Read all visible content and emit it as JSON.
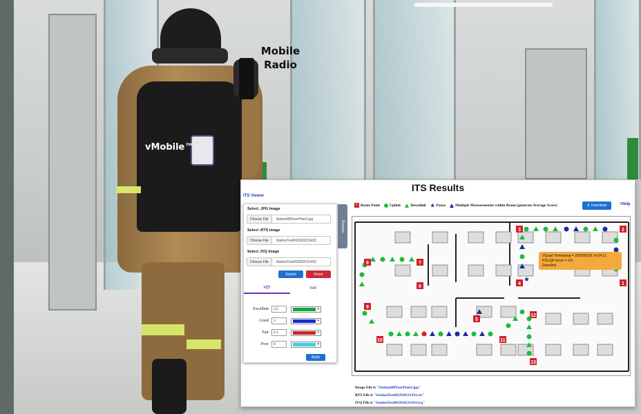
{
  "photo": {
    "mobile_radio_label": "Mobile\nRadio",
    "vmobile_label": "vMobile™"
  },
  "its": {
    "title": "ITS Results",
    "viewer_label": "ITS Viewer",
    "legend": {
      "route_point": "Route Point",
      "uplink": "Uplink",
      "downlink": "Downlink",
      "pause": "Pause",
      "multiple": "Multiple Measurements within Room (generate Average Score)"
    },
    "download_label": "Download",
    "help_label": "Help",
    "browse_tab": "Browse",
    "controls": {
      "jpg_label": "Select .JPG Image",
      "rts_label": "Select .RTS Image",
      "ivq_label": "Select .IVQ Image",
      "choose_file": "Choose File",
      "jpg_file": "Station80FloorPlan2.jpg",
      "rts_file": "StationTest062920231433",
      "ivq_file": "StationTest062920231433",
      "submit": "Submit",
      "reset": "Reset",
      "tab_vqt": "VQT",
      "tab_bab": "BAB",
      "apply": "Apply",
      "thresholds": [
        {
          "name": "Excellent",
          "value": "3.5",
          "color": "#1aa33a"
        },
        {
          "name": "Good",
          "value": "3",
          "color": "#1c2bd6"
        },
        {
          "name": "Fair",
          "value": "2.5",
          "color": "#d0202a"
        },
        {
          "name": "Poor",
          "value": "0",
          "color": "#3fd0e0"
        }
      ]
    },
    "tooltip": {
      "line1": "VQuad Timestamp = 2023/06/29 14:34:11",
      "line2": "POLQA Score = 4.5",
      "line3": "Downlink"
    },
    "files": {
      "image_label": "Image File is",
      "image_value": "\"Station80FloorPlan2.jpg\"",
      "rts_label": "RTS File is",
      "rts_value": "\"StationTest062920231433.rts\"",
      "ivq_label": "IVQ File is",
      "ivq_value": "\"StationTest062920231433.ivq\""
    },
    "route_points": [
      "1",
      "2",
      "3",
      "4",
      "5",
      "6",
      "7",
      "8",
      "9",
      "10",
      "11",
      "12",
      "13"
    ]
  }
}
